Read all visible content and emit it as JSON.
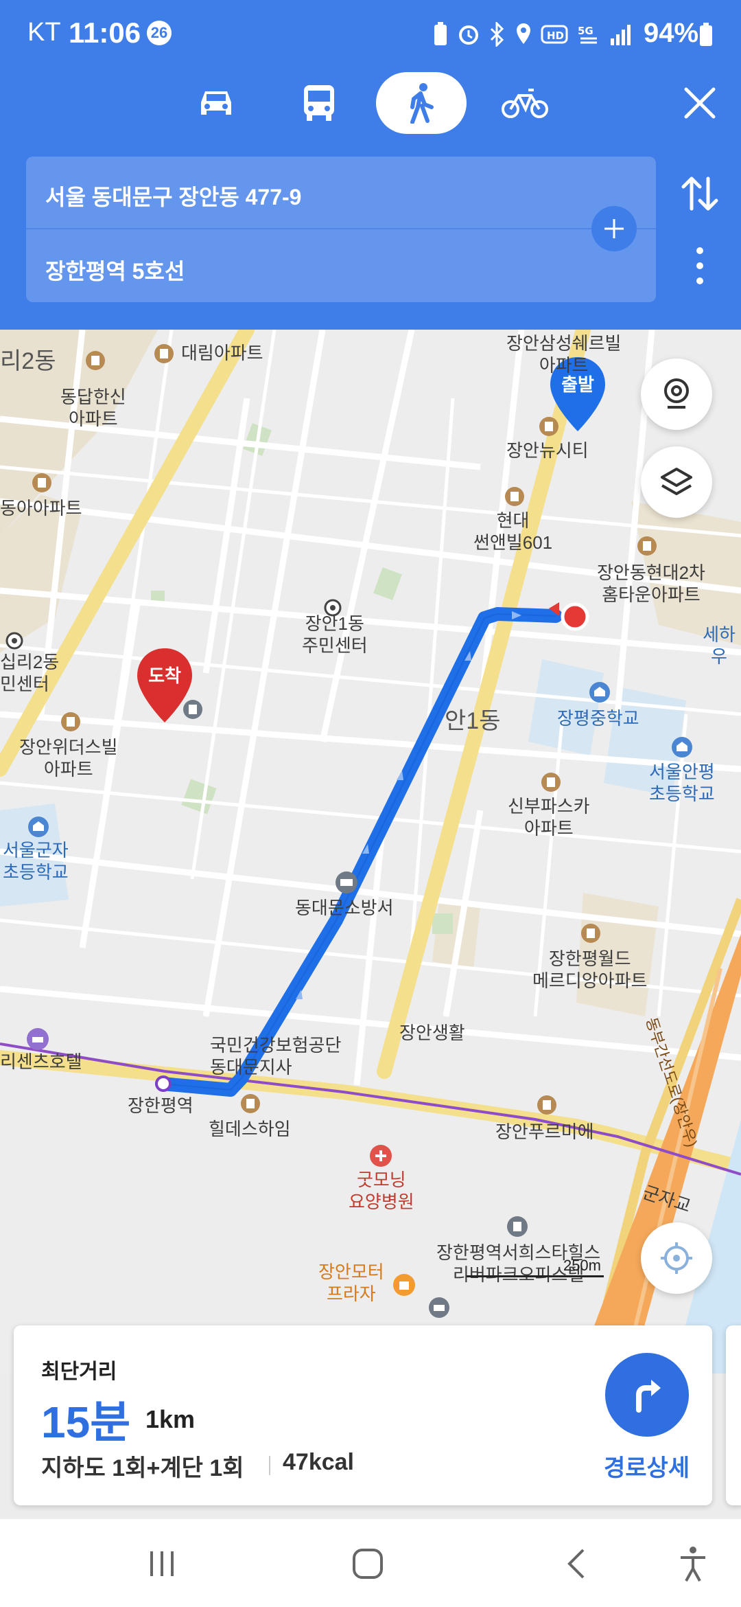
{
  "status_bar": {
    "carrier": "KT",
    "time": "11:06",
    "notification_count": "26",
    "battery": "94%"
  },
  "transport_modes": [
    {
      "name": "car",
      "icon": "car-icon",
      "active": false
    },
    {
      "name": "bus",
      "icon": "bus-icon",
      "active": false
    },
    {
      "name": "walk",
      "icon": "walk-icon",
      "active": true
    },
    {
      "name": "bike",
      "icon": "bike-icon",
      "active": false
    }
  ],
  "route": {
    "origin": "서울 동대문구 장안동 477-9",
    "destination": "장한평역 5호선"
  },
  "map": {
    "start_marker": "출발",
    "end_marker": "도착",
    "scale": "250m",
    "labels": {
      "jangan_samsung": "장안삼성쉐르빌\n아파트",
      "daerim": "대림아파트",
      "dongdap": "동답한신\n아파트",
      "ri2dong": "리2동",
      "jangan_newcity": "장안뉴시티",
      "hyundai_sunnyville": "현대\n썬앤빌601",
      "donga": "동아아파트",
      "hyundai2": "장안동현대2차\n홈타운아파트",
      "jangan1_center": "장안1동\n주민센터",
      "sipri_center": "십리2동\n민센터",
      "sehau": "세하우",
      "jangpyeong_ms": "장평중학교",
      "jangan1dong": "안1동",
      "windersville": "장안위더스빌\n아파트",
      "seoulanpyeong": "서울안평\n초등학교",
      "sinbu": "신부파스카\n아파트",
      "gunja_es": "서울군자\n초등학교",
      "fire_station": "동대문소방서",
      "world_meridian": "장한평월드\n메르디앙아파트",
      "nhis": "국민건강보험공단\n동대문지사",
      "jangan_life": "장안생활",
      "hotel": "리센츠호텔",
      "station": "장한평역",
      "premier": "장안푸르미에",
      "hilldes": "힐데스하임",
      "goodmorning": "굿모닝\n요양병원",
      "motor_plaza": "장안모터\n프라자",
      "hills_state": "장한평역서희스타힐스\n리버파크오피스텔",
      "gunja_bridge": "군자교",
      "expressway": "동부간선도로(장안우)"
    }
  },
  "summary": {
    "title": "최단거리",
    "time": "15분",
    "distance": "1km",
    "detail": "지하도 1회+계단 1회",
    "calories": "47kcal",
    "directions_label": "경로상세"
  },
  "colors": {
    "header": "#3f7ee8",
    "route": "#1f6fe8",
    "accent": "#2f6fe0",
    "end_marker": "#d9302f"
  }
}
